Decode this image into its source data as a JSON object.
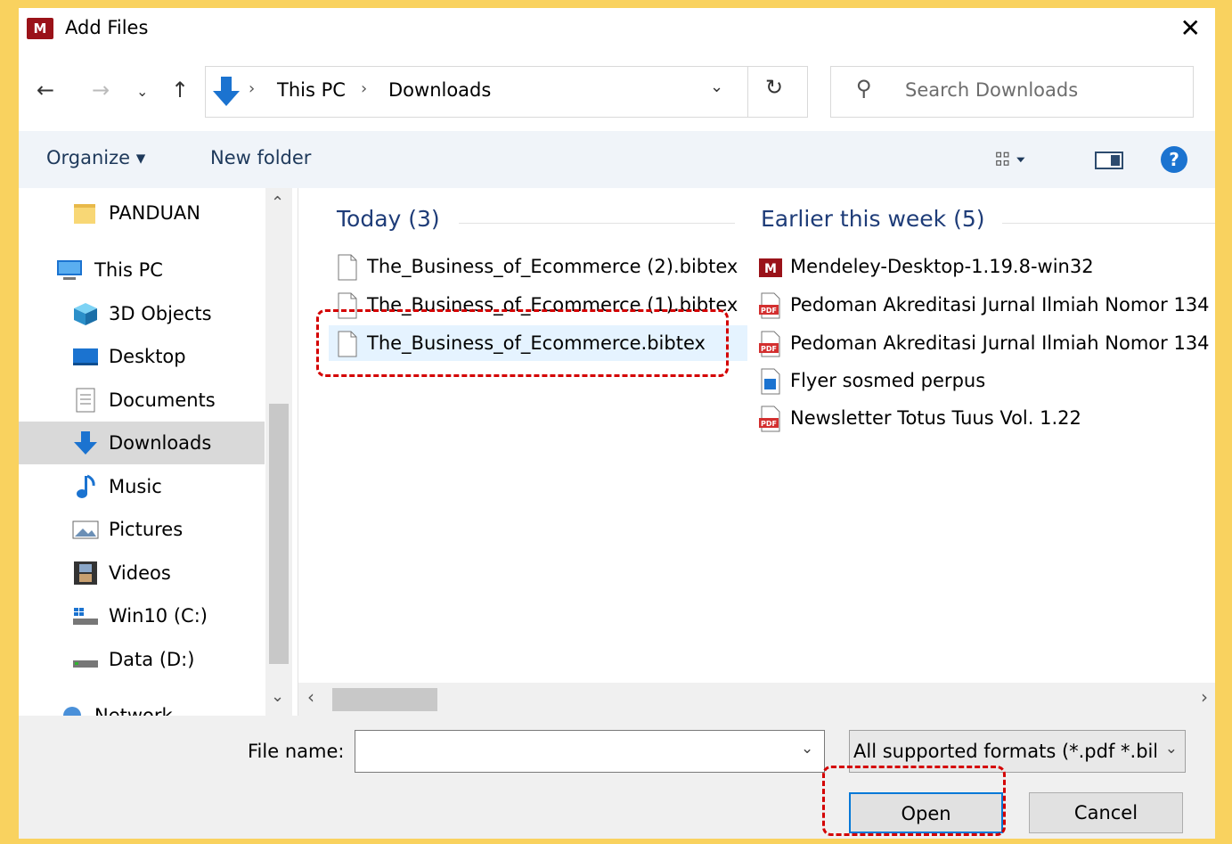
{
  "window": {
    "title": "Add Files",
    "app_icon_text": "M"
  },
  "nav": {
    "breadcrumbs": [
      "This PC",
      "Downloads"
    ],
    "search_placeholder": "Search Downloads"
  },
  "toolbar": {
    "organize_label": "Organize ▾",
    "new_folder_label": "New folder",
    "help_label": "?"
  },
  "sidebar": {
    "items": [
      {
        "label": "PANDUAN",
        "icon": "folder-icon"
      },
      {
        "label": "This PC",
        "icon": "computer-icon"
      },
      {
        "label": "3D Objects",
        "icon": "cube-icon"
      },
      {
        "label": "Desktop",
        "icon": "desktop-icon"
      },
      {
        "label": "Documents",
        "icon": "document-icon"
      },
      {
        "label": "Downloads",
        "icon": "download-arrow-icon",
        "selected": true
      },
      {
        "label": "Music",
        "icon": "music-note-icon"
      },
      {
        "label": "Pictures",
        "icon": "picture-icon"
      },
      {
        "label": "Videos",
        "icon": "film-icon"
      },
      {
        "label": "Win10 (C:)",
        "icon": "drive-icon"
      },
      {
        "label": "Data (D:)",
        "icon": "drive-icon"
      },
      {
        "label": "Network",
        "icon": "network-icon"
      }
    ]
  },
  "groups": {
    "today": {
      "header": "Today (3)",
      "files": [
        "The_Business_of_Ecommerce (2).bibtex",
        "The_Business_of_Ecommerce (1).bibtex",
        "The_Business_of_Ecommerce.bibtex"
      ]
    },
    "earlier": {
      "header": "Earlier this week (5)",
      "files": [
        "Mendeley-Desktop-1.19.8-win32",
        "Pedoman Akreditasi Jurnal Ilmiah Nomor 134",
        "Pedoman Akreditasi Jurnal Ilmiah Nomor 134",
        "Flyer sosmed perpus",
        "Newsletter Totus Tuus Vol. 1.22"
      ],
      "icons": [
        "mendeley-icon",
        "pdf-icon",
        "pdf-icon",
        "image-file-icon",
        "pdf-icon"
      ]
    }
  },
  "bottom": {
    "file_name_label": "File name:",
    "file_name_value": "",
    "filter_value": "All supported formats (*.pdf *.bibtex",
    "open_label": "Open",
    "cancel_label": "Cancel"
  },
  "colors": {
    "highlight": "#d40000",
    "selection": "#e5f3ff",
    "accent": "#0078d7",
    "background": "#f9d25f"
  }
}
